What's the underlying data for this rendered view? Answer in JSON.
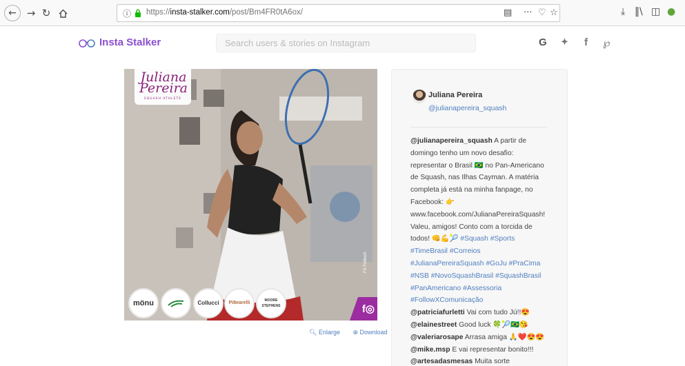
{
  "browser": {
    "url_prefix": "https://",
    "url_domain": "insta-stalker.com",
    "url_path": "/post/Bm4FR0tA6ox/",
    "icons": [
      "back-icon",
      "forward-icon",
      "reload-icon",
      "home-icon",
      "info-icon",
      "lock-icon",
      "reader-icon",
      "more-icon",
      "pocket-icon",
      "star-icon",
      "download-icon",
      "library-icon",
      "sidebar-icon",
      "extension-icon"
    ]
  },
  "site": {
    "logo_text": "Insta Stalker",
    "search_placeholder": "Search users & stories on Instagram",
    "social": {
      "google": "G",
      "twitter": "✦",
      "facebook": "f",
      "pinterest": "℘"
    }
  },
  "post_image": {
    "brand_name": "Juliana Pereira",
    "brand_sub": "SQUASH ATHLETE",
    "sponsors": [
      "mönu",
      "",
      "",
      "Pi8earelli",
      "MOORE STEPHENS"
    ],
    "colucci": "Collucci",
    "corner": "f◎",
    "watermark": "FX FollowX",
    "enlarge": "Enlarge",
    "download": "Download"
  },
  "profile": {
    "name": "Juliana Pereira",
    "handle": "@julianapereira_squash"
  },
  "caption": {
    "l1_user": "@julianapereira_squash",
    "l1": " A partir de",
    "l2": "domingo tenho um novo desafio:",
    "l3": "representar o Brasil 🇧🇷 no Pan-Americano",
    "l4": "de Squash, nas Ilhas Cayman. A matéria",
    "l5": "completa já está na minha fanpage, no",
    "l6": "Facebook: 👉",
    "l7": "www.facebook.com/JulianaPereiraSquash!",
    "l8": "Valeu, amigos! Conto com a torcida de",
    "l9": "todos! 👊💪🎾",
    "l9_tags": " #Squash #Sports",
    "l10": "#TimeBrasil #Correios",
    "l11": "#JulianaPereiraSquash #GoJu #PraCima",
    "l12": "#NSB #NovoSquashBrasil #SquashBrasil",
    "l13": "#PanAmericano #Assessoria",
    "l14": "#FollowXComunicação"
  },
  "comments": [
    {
      "user": "@patriciafurletti",
      "text": " Vai com tudo Jú!!😍"
    },
    {
      "user": "@elainestreet",
      "text": " Good luck 🍀🎾🇧🇷😘"
    },
    {
      "user": "@valeriarosape",
      "text": " Arrasa amiga 🙏❤️😍😍"
    },
    {
      "user": "@mike.msp",
      "text": " E vai representar bonito!!!"
    },
    {
      "user": "@artesadasmesas",
      "text": " Muita sorte"
    }
  ]
}
